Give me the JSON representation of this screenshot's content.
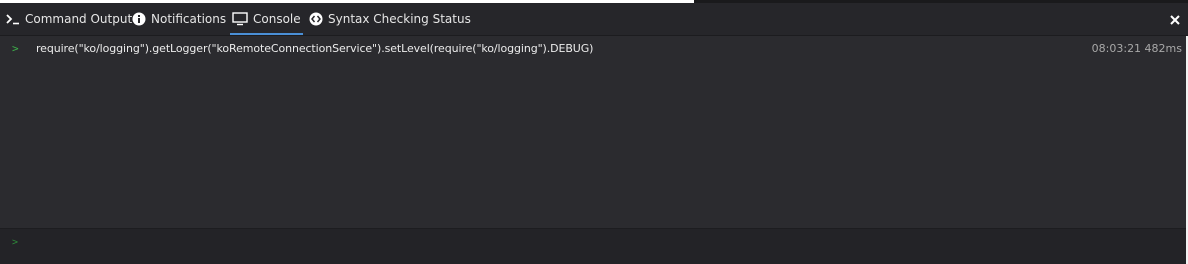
{
  "tabs": [
    {
      "label": "Command Output",
      "icon": "terminal-icon",
      "active": false
    },
    {
      "label": "Notifications",
      "icon": "info-icon",
      "active": false
    },
    {
      "label": "Console",
      "icon": "monitor-icon",
      "active": true
    },
    {
      "label": "Syntax Checking Status",
      "icon": "code-diamond-icon",
      "active": false
    }
  ],
  "close_label": "✕",
  "console": {
    "entries": [
      {
        "prompt": ">",
        "text": "require(\"ko/logging\").getLogger(\"koRemoteConnectionService\").setLevel(require(\"ko/logging\").DEBUG)",
        "time": "08:03:21 482ms"
      }
    ],
    "input_prompt": ">",
    "input_value": ""
  },
  "colors": {
    "accent": "#4a8fd6",
    "prompt": "#3db04a",
    "background": "#2b2b2f"
  }
}
